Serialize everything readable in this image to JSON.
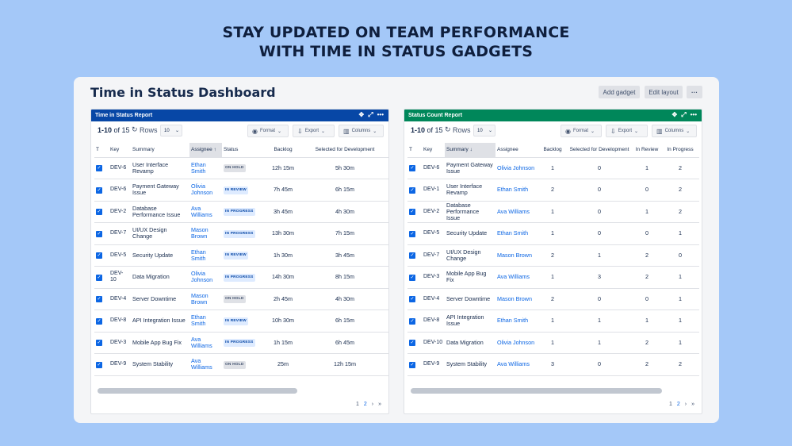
{
  "headline": {
    "line1": "STAY UPDATED ON TEAM PERFORMANCE",
    "line2": "WITH TIME IN STATUS GADGETS"
  },
  "dashboard": {
    "title": "Time in Status Dashboard",
    "add_gadget": "Add gadget",
    "edit_layout": "Edit layout",
    "more": "···"
  },
  "icons": {
    "move": "✥",
    "expand": "⤢",
    "menu": "•••",
    "refresh": "↻",
    "chevron": "⌄",
    "format": "◉",
    "export": "⇩",
    "columns": "▥"
  },
  "controls": {
    "range_a": "1-10",
    "range_b": " of 15",
    "rows_label": "Rows",
    "rows_value": "10",
    "format": "Format",
    "export": "Export",
    "columns": "Columns"
  },
  "pager": {
    "p1": "1",
    "p2": "2",
    "next": "›",
    "last": "»"
  },
  "panel1": {
    "title": "Time in Status Report",
    "header_color": "#0747a6",
    "columns": [
      "T",
      "Key",
      "Summary",
      "Assignee ↑",
      "Status",
      "Backlog",
      "Selected for Development"
    ],
    "rows": [
      {
        "key": "DEV-6",
        "summary": "User Interface Revamp",
        "assignee": "Ethan Smith",
        "status": "ON HOLD",
        "backlog": "12h 15m",
        "sfd": "5h 30m"
      },
      {
        "key": "DEV-6",
        "summary": "Payment Gateway Issue",
        "assignee": "Olivia Johnson",
        "status": "IN REVIEW",
        "backlog": "7h 45m",
        "sfd": "6h 15m"
      },
      {
        "key": "DEV-2",
        "summary": "Database Performance Issue",
        "assignee": "Ava Williams",
        "status": "IN PROGRESS",
        "backlog": "3h 45m",
        "sfd": "4h 30m"
      },
      {
        "key": "DEV-7",
        "summary": "UI/UX Design Change",
        "assignee": "Mason Brown",
        "status": "IN PROGRESS",
        "backlog": "13h 30m",
        "sfd": "7h 15m"
      },
      {
        "key": "DEV-5",
        "summary": "Security Update",
        "assignee": "Ethan Smith",
        "status": "IN REVIEW",
        "backlog": "1h 30m",
        "sfd": "3h 45m"
      },
      {
        "key": "DEV-10",
        "summary": "Data Migration",
        "assignee": "Olivia Johnson",
        "status": "IN PROGRESS",
        "backlog": "14h 30m",
        "sfd": "8h 15m"
      },
      {
        "key": "DEV-4",
        "summary": "Server Downtime",
        "assignee": "Mason Brown",
        "status": "ON HOLD",
        "backlog": "2h 45m",
        "sfd": "4h 30m"
      },
      {
        "key": "DEV-8",
        "summary": "API Integration Issue",
        "assignee": "Ethan Smith",
        "status": "IN REVIEW",
        "backlog": "10h 30m",
        "sfd": "6h 15m"
      },
      {
        "key": "DEV-3",
        "summary": "Mobile App Bug Fix",
        "assignee": "Ava Williams",
        "status": "IN PROGRESS",
        "backlog": "1h 15m",
        "sfd": "6h 45m"
      },
      {
        "key": "DEV-9",
        "summary": "System Stability",
        "assignee": "Ava Williams",
        "status": "ON HOLD",
        "backlog": "25m",
        "sfd": "12h 15m"
      }
    ]
  },
  "panel2": {
    "title": "Status Count Report",
    "header_color": "#00875a",
    "columns": [
      "T",
      "Key",
      "Summary ↓",
      "Assignee",
      "Backlog",
      "Selected for Development",
      "In Review",
      "In Progress"
    ],
    "rows": [
      {
        "key": "DEV-6",
        "summary": "Payment Gateway Issue",
        "assignee": "Olivia Johnson",
        "backlog": "1",
        "sfd": "0",
        "review": "1",
        "progress": "2"
      },
      {
        "key": "DEV-1",
        "summary": "User Interface Revamp",
        "assignee": "Ethan Smith",
        "backlog": "2",
        "sfd": "0",
        "review": "0",
        "progress": "2"
      },
      {
        "key": "DEV-2",
        "summary": "Database Performance Issue",
        "assignee": "Ava Williams",
        "backlog": "1",
        "sfd": "0",
        "review": "1",
        "progress": "2"
      },
      {
        "key": "DEV-5",
        "summary": "Security Update",
        "assignee": "Ethan Smith",
        "backlog": "1",
        "sfd": "0",
        "review": "0",
        "progress": "1"
      },
      {
        "key": "DEV-7",
        "summary": "UI/UX Design Change",
        "assignee": "Mason Brown",
        "backlog": "2",
        "sfd": "1",
        "review": "2",
        "progress": "0"
      },
      {
        "key": "DEV-3",
        "summary": "Mobile App Bug Fix",
        "assignee": "Ava Williams",
        "backlog": "1",
        "sfd": "3",
        "review": "2",
        "progress": "1"
      },
      {
        "key": "DEV-4",
        "summary": "Server Downtime",
        "assignee": "Mason Brown",
        "backlog": "2",
        "sfd": "0",
        "review": "0",
        "progress": "1"
      },
      {
        "key": "DEV-8",
        "summary": "API Integration Issue",
        "assignee": "Ethan Smith",
        "backlog": "1",
        "sfd": "1",
        "review": "1",
        "progress": "1"
      },
      {
        "key": "DEV-10",
        "summary": "Data Migration",
        "assignee": "Olivia Johnson",
        "backlog": "1",
        "sfd": "1",
        "review": "2",
        "progress": "1"
      },
      {
        "key": "DEV-9",
        "summary": "System Stability",
        "assignee": "Ava Williams",
        "backlog": "3",
        "sfd": "0",
        "review": "2",
        "progress": "2"
      }
    ]
  }
}
